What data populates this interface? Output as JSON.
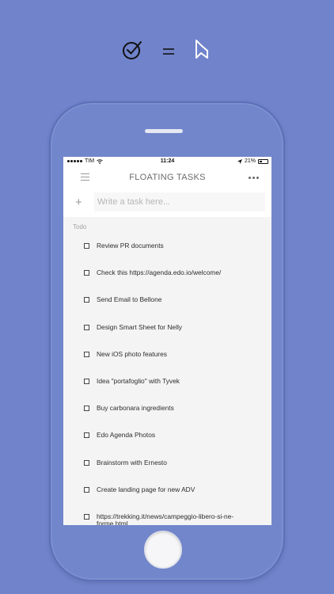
{
  "status_bar": {
    "carrier": "TIM",
    "time": "11:24",
    "battery": "21%"
  },
  "navbar": {
    "title": "FLOATING TASKS"
  },
  "new_task": {
    "placeholder": "Write a task here..."
  },
  "section_label": "Todo",
  "tasks": [
    {
      "label": "Review PR documents"
    },
    {
      "label": "Check this https://agenda.edo.io/welcome/"
    },
    {
      "label": "Send Email to Bellone"
    },
    {
      "label": "Design Smart Sheet for Nelly"
    },
    {
      "label": "New iOS photo features"
    },
    {
      "label": "Idea \"portafoglio\" with Tyvek"
    },
    {
      "label": "Buy carbonara ingredients"
    },
    {
      "label": "Edo Agenda Photos"
    },
    {
      "label": "Brainstorm with Ernesto"
    },
    {
      "label": "Create landing page for new ADV"
    },
    {
      "label": "https://trekking.it/news/campeggio-libero-si-ne-forme.html"
    }
  ],
  "colors": {
    "background": "#7083cb",
    "screen": "#f4f4f5"
  },
  "icons": [
    "check-circle-icon",
    "equals-icon",
    "bookmark-icon",
    "menu-icon",
    "more-icon",
    "plus-icon",
    "wifi-icon",
    "location-icon",
    "battery-icon"
  ]
}
